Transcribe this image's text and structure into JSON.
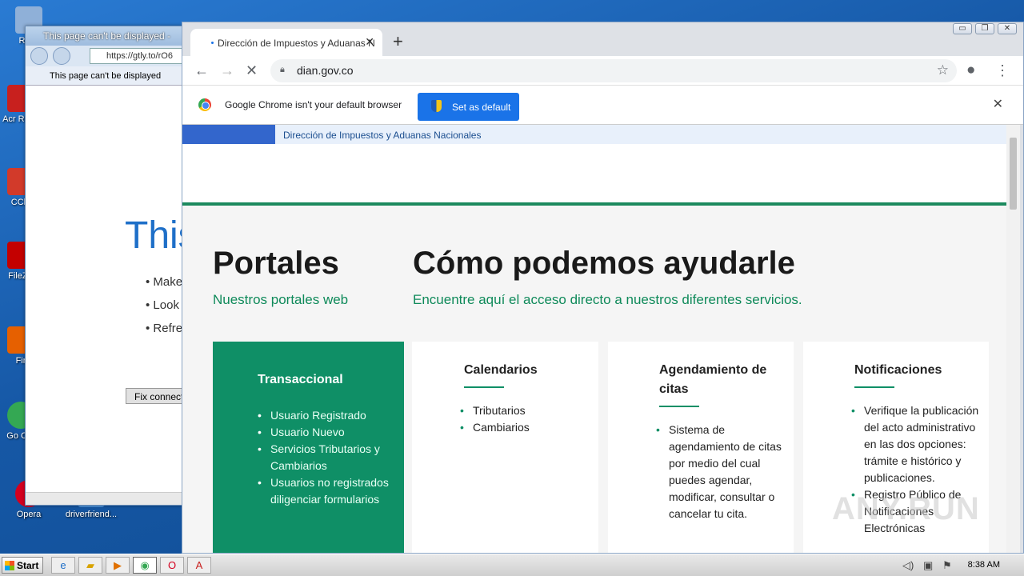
{
  "desktop": {
    "icons": [
      {
        "label": "Recy",
        "color": "#8fb0d8"
      },
      {
        "label": "Acr Read",
        "color": "#c8201e"
      },
      {
        "label": "CCle",
        "color": "#d23a2a"
      },
      {
        "label": "FileZill",
        "color": "#c40000"
      },
      {
        "label": "Fir",
        "color": "#e66000"
      },
      {
        "label": "Go Chr",
        "color": "#34a853"
      },
      {
        "label": "Opera",
        "color": "#d4001f"
      },
      {
        "label": "driverfriend...",
        "color": "#4a90d9"
      }
    ]
  },
  "ie": {
    "title": "This page can't be displayed -",
    "address": "https://gtly.to/rO6",
    "tab_label": "This page can't be displayed",
    "heading": "This",
    "bullets": [
      "Make",
      "Look",
      "Refre"
    ],
    "fix_button": "Fix connect"
  },
  "chrome": {
    "tab_title": "Dirección de Impuestos y Aduanas N",
    "new_tab": "+",
    "url": "dian.gov.co",
    "infobar_text": "Google Chrome isn't your default browser",
    "set_default": "Set as default",
    "window_buttons": [
      "▭",
      "❐",
      "✕"
    ]
  },
  "page": {
    "strip_text": "Dirección de Impuestos y Aduanas Nacionales",
    "portales_title": "Portales",
    "portales_sub": "Nuestros portales web",
    "ayuda_title": "Cómo podemos ayudarle",
    "ayuda_sub": "Encuentre aquí el acceso directo a nuestros diferentes servicios.",
    "cards": [
      {
        "title": "Transaccional",
        "items": [
          "Usuario Registrado",
          "Usuario Nuevo",
          "Servicios Tributarios y Cambiarios",
          "Usuarios no registrados diligenciar formularios"
        ]
      },
      {
        "title": "Calendarios",
        "items": [
          "Tributarios",
          "Cambiarios"
        ]
      },
      {
        "title": "Agendamiento de citas",
        "items": [
          "Sistema de agendamiento de citas por medio del cual puedes agendar, modificar, consultar o cancelar tu cita."
        ]
      },
      {
        "title": "Notificaciones",
        "items": [
          "Verifique la publicación del acto administrativo en las dos opciones: trámite e histórico y publicaciones.",
          "Registro Público de Notificaciones Electrónicas"
        ]
      }
    ]
  },
  "taskbar": {
    "start": "Start",
    "clock": "8:38 AM"
  },
  "watermark": "ANY.RUN"
}
